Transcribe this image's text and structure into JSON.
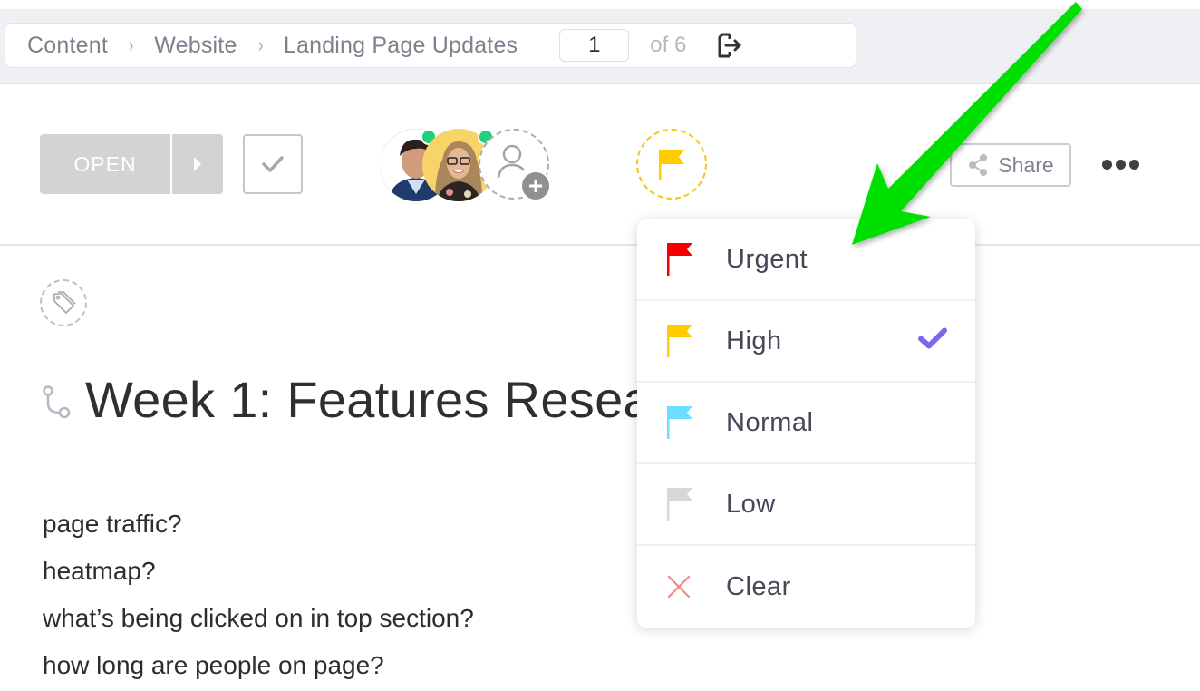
{
  "breadcrumb": {
    "items": [
      "Content",
      "Website",
      "Landing Page Updates"
    ],
    "separator": "›",
    "page_current": "1",
    "page_of_label": "of 6",
    "exit_icon": "exit-icon"
  },
  "toolbar": {
    "status_label": "OPEN",
    "status_color": "#d3d3d3",
    "complete_icon": "checkmark-icon",
    "assignees": [
      {
        "name": "assignee-1",
        "online": true
      },
      {
        "name": "assignee-2",
        "online": true
      }
    ],
    "add_assignee_icon": "add-user-icon",
    "priority_current": "High",
    "priority_icon": "flag-icon",
    "share_label": "Share",
    "share_icon": "share-icon",
    "more_icon": "more-dots-icon"
  },
  "task": {
    "tag_icon": "tag-icon",
    "subtask_icon": "subtask-icon",
    "title": "Week 1: Features Resea",
    "description_lines": [
      "page traffic?",
      "heatmap?",
      "what’s being clicked on in top section?",
      "how long are people on page?"
    ]
  },
  "priority_menu": {
    "items": [
      {
        "label": "Urgent",
        "color": "#f50000",
        "icon": "flag-icon",
        "selected": false
      },
      {
        "label": "High",
        "color": "#ffcc00",
        "icon": "flag-icon",
        "selected": true
      },
      {
        "label": "Normal",
        "color": "#6fddff",
        "icon": "flag-icon",
        "selected": false
      },
      {
        "label": "Low",
        "color": "#d8d8d8",
        "icon": "flag-icon",
        "selected": false
      },
      {
        "label": "Clear",
        "color": "#f08a84",
        "icon": "close-icon",
        "selected": false
      }
    ],
    "check_color": "#7b68ee"
  },
  "annotation": {
    "arrow_color": "#00e000"
  }
}
